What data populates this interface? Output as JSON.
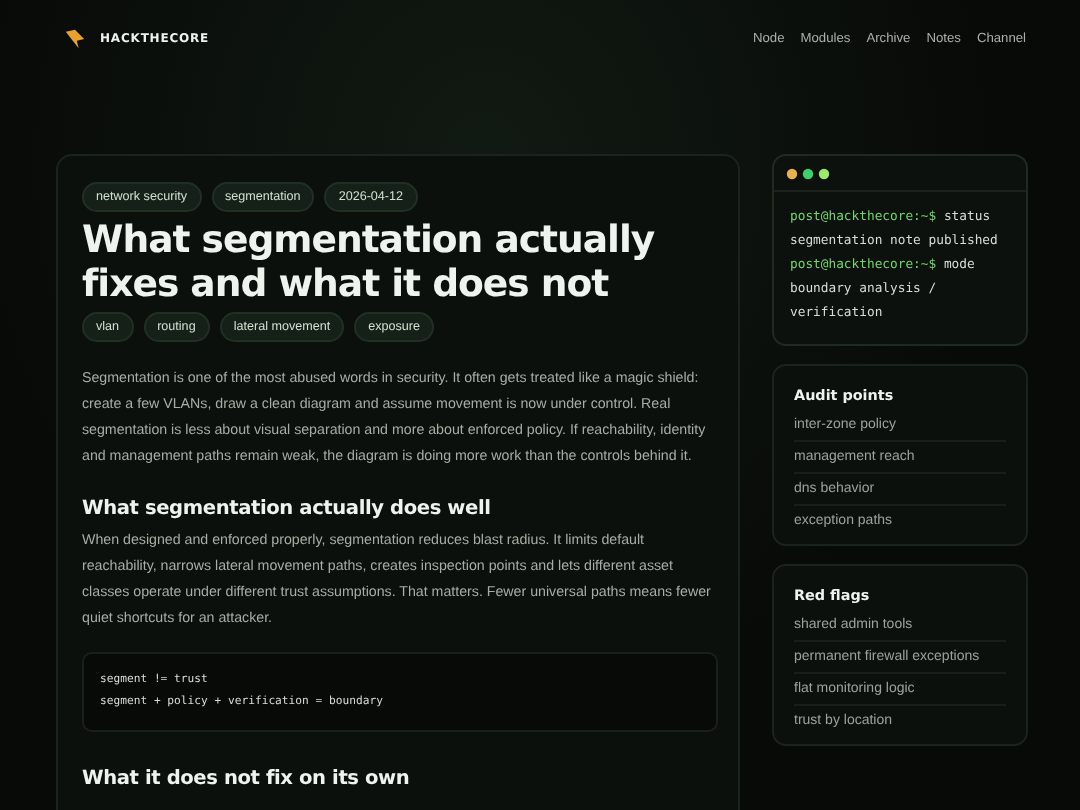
{
  "brand": {
    "name": "HACKTHECORE"
  },
  "nav": [
    "Node",
    "Modules",
    "Archive",
    "Notes",
    "Channel"
  ],
  "article": {
    "tags": [
      "network security",
      "segmentation",
      "2026-04-12"
    ],
    "title": "What segmentation actually fixes and what it does not",
    "topics": [
      "vlan",
      "routing",
      "lateral movement",
      "exposure"
    ],
    "intro": "Segmentation is one of the most abused words in security. It often gets treated like a magic shield: create a few VLANs, draw a clean diagram and assume movement is now under control. Real segmentation is less about visual separation and more about enforced policy. If reachability, identity and management paths remain weak, the diagram is doing more work than the controls behind it.",
    "sections": [
      {
        "heading": "What segmentation actually does well",
        "text": "When designed and enforced properly, segmentation reduces blast radius. It limits default reachability, narrows lateral movement paths, creates inspection points and lets different asset classes operate under different trust assumptions. That matters. Fewer universal paths means fewer quiet shortcuts for an attacker.",
        "code": [
          "segment != trust",
          "segment + policy + verification = boundary"
        ]
      },
      {
        "heading": "What it does not fix on its own"
      }
    ]
  },
  "terminal": {
    "lines": [
      {
        "kind": "prompt",
        "prompt": "post@hackthecore:~$",
        "text": "status"
      },
      {
        "kind": "output",
        "text": "segmentation note published"
      },
      {
        "kind": "prompt",
        "prompt": "post@hackthecore:~$",
        "text": "mode"
      },
      {
        "kind": "output",
        "text": "boundary analysis / verification"
      }
    ]
  },
  "panels": [
    {
      "title": "Audit points",
      "items": [
        "inter-zone policy",
        "management reach",
        "dns behavior",
        "exception paths"
      ]
    },
    {
      "title": "Red flags",
      "items": [
        "shared admin tools",
        "permanent firewall exceptions",
        "flat monitoring logic",
        "trust by location"
      ]
    }
  ]
}
